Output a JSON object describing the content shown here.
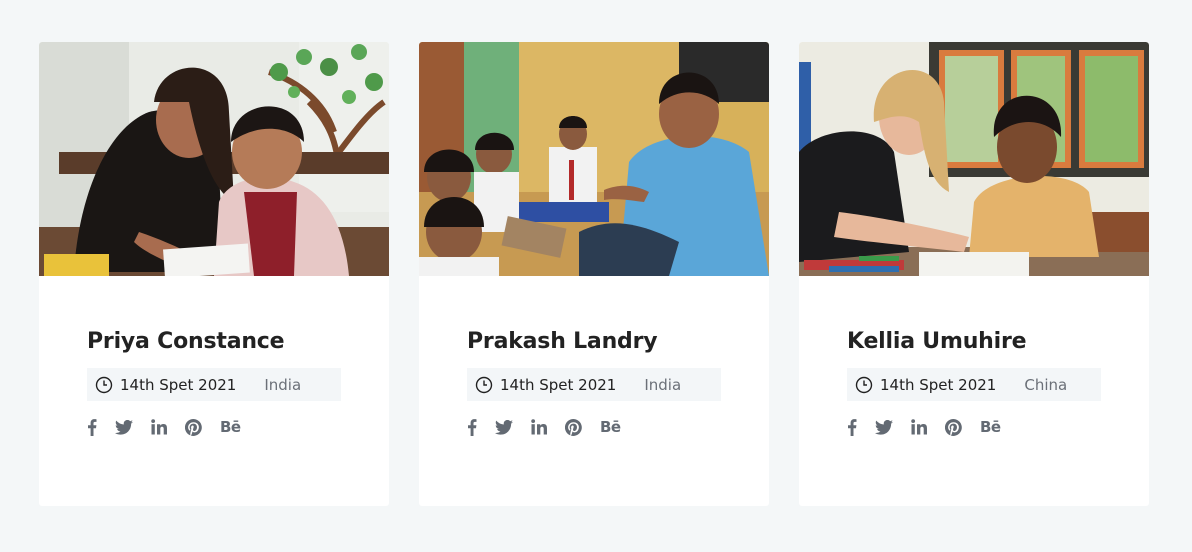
{
  "cards": [
    {
      "name": "Priya Constance",
      "date": "14th Spet 2021",
      "location": "India",
      "photo": "girl-helping-boy-write-photo"
    },
    {
      "name": "Prakash Landry",
      "date": "14th Spet 2021",
      "location": "India",
      "photo": "teacher-with-children-photo"
    },
    {
      "name": "Kellia Umuhire",
      "date": "14th Spet 2021",
      "location": "China",
      "photo": "volunteer-laughing-with-boy-photo"
    }
  ],
  "social_icons": [
    "facebook-icon",
    "twitter-icon",
    "linkedin-icon",
    "pinterest-icon",
    "behance-icon"
  ],
  "behance_label": "Bē",
  "colors": {
    "background": "#f4f7f8",
    "card": "#ffffff",
    "meta_bg": "#f3f6f8",
    "title": "#222222",
    "muted": "#6b7078",
    "icon": "#636a73"
  }
}
